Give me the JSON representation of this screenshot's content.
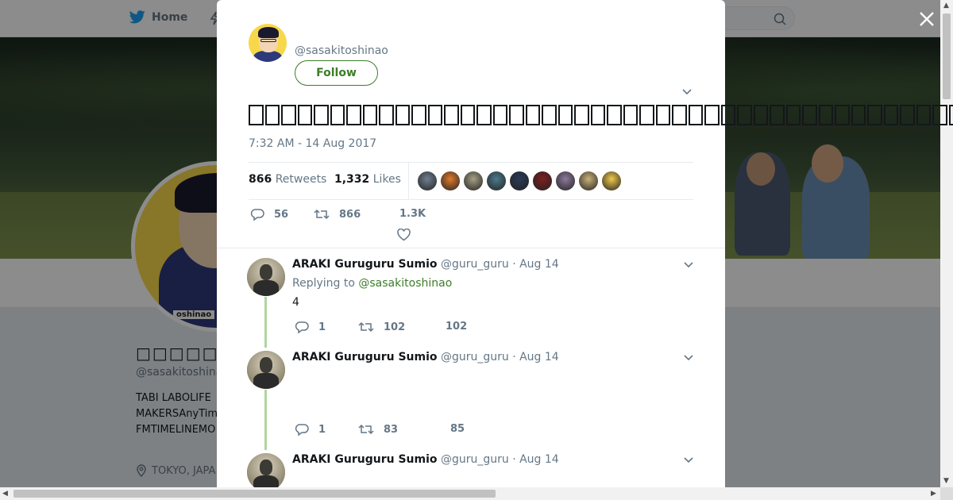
{
  "nav": {
    "home_label": "Home"
  },
  "profile": {
    "name": "□□□□□□",
    "handle": "@sasakitoshinao",
    "avatar_tag": "oshinao",
    "bio_lines": [
      "TABI LABOLIFE",
      "MAKERSAnyTim",
      "FMTIMELINEMO"
    ],
    "location": "TOKYO, JAPA"
  },
  "tweet": {
    "handle": "@sasakitoshinao",
    "follow_label": "Follow",
    "text_glyph": "□",
    "text_box_count": 45,
    "date": "7:32 AM - 14 Aug 2017",
    "retweets_count": "866",
    "retweets_label": "Retweets",
    "likes_count": "1,332",
    "likes_label": "Likes",
    "likers": [
      "#6f7f8f",
      "#e07a2c",
      "#a6a085",
      "#4c7a8c",
      "#2a3b55",
      "#7d1f1f",
      "#8c7a9a",
      "#c9b27a",
      "#f2c94c"
    ],
    "actions": {
      "replies": "56",
      "retweets": "866",
      "likes": "1.3K"
    }
  },
  "replies": [
    {
      "name": "ARAKI Guruguru Sumio",
      "handle": "@guru_guru",
      "date": "· Aug 14",
      "replying_prefix": "Replying to",
      "replying_to": "@sasakitoshinao",
      "text": "4",
      "replies": "1",
      "retweets": "102",
      "likes": "102"
    },
    {
      "name": "ARAKI Guruguru Sumio",
      "handle": "@guru_guru",
      "date": "· Aug 14",
      "text": "",
      "replies": "1",
      "retweets": "83",
      "likes": "85"
    },
    {
      "name": "ARAKI Guruguru Sumio",
      "handle": "@guru_guru",
      "date": "· Aug 14"
    }
  ],
  "colors": {
    "accent": "#3c7d29",
    "muted": "#657786",
    "thread": "#aed59e"
  }
}
